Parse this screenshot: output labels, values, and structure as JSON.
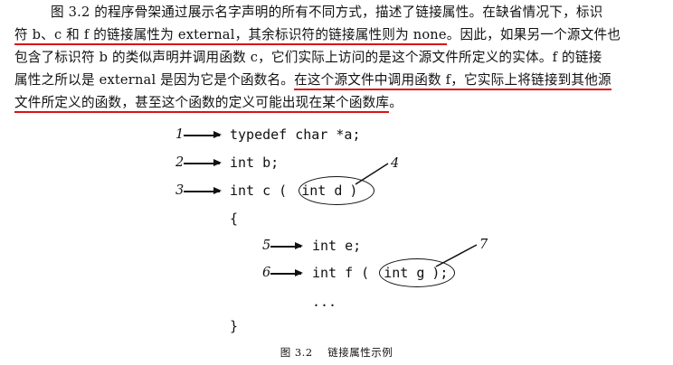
{
  "paragraph": {
    "line1": "图 3.2 的程序骨架通过展示名字声明的所有不同方式，描述了链接属性。在缺省情况下，标识",
    "line2_underlined": "符 b、c 和 f 的链接属性为 external，其余标识符的链接属性则为 none",
    "line2_rest": "。因此，如果另一个源文件也",
    "line3": "包含了标识符 b 的类似声明并调用函数 c，它们实际上访问的是这个源文件所定义的实体。f 的链接",
    "line4_plain": "属性之所以是 external 是因为它是个函数名。",
    "line4_underlined": "在这个源文件中调用函数 f，它实际上将链接到其他源",
    "line5_underlined": "文件所定义的函数，甚至这个函数的定义可能出现在某个函数库",
    "line5_rest": "。"
  },
  "code": {
    "l1": "typedef char *a;",
    "l2": "int b;",
    "l3_a": "int c (",
    "l3_b": "int d",
    "l3_c": ")",
    "l4": "{",
    "l5": "int e;",
    "l6_a": "int f (",
    "l6_b": "int g",
    "l6_c": ");",
    "l7": "...",
    "l8": "}"
  },
  "callouts": {
    "n1": "1",
    "n2": "2",
    "n3": "3",
    "n4": "4",
    "n5": "5",
    "n6": "6",
    "n7": "7"
  },
  "caption": "图 3.2    链接属性示例",
  "colors": {
    "underline": "#d81414",
    "text": "#111111"
  }
}
